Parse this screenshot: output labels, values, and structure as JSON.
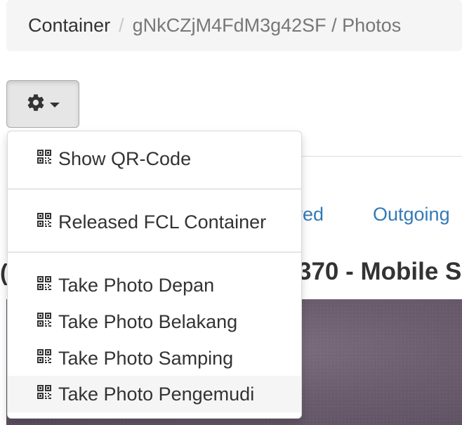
{
  "breadcrumb": {
    "home": "Container",
    "separator": "/",
    "current": "gNkCZjM4FdM3g42SF / Photos"
  },
  "toolbar": {
    "gear_icon": "gear-icon",
    "caret_icon": "caret-down-icon"
  },
  "background": {
    "tab_partial": "red",
    "tab_outgoing": "Outgoing",
    "heading_partial": "370 - Mobile S",
    "heading_left_partial": "("
  },
  "menu": {
    "icon": "qrcode-icon",
    "items": [
      {
        "label": "Show QR-Code"
      },
      {
        "label": "Released FCL Container"
      },
      {
        "label": "Take Photo Depan"
      },
      {
        "label": "Take Photo Belakang"
      },
      {
        "label": "Take Photo Samping"
      },
      {
        "label": "Take Photo Pengemudi"
      }
    ]
  },
  "colors": {
    "link": "#337ab7",
    "breadcrumb_bg": "#f5f5f5",
    "photo": "#6a5c6d"
  }
}
